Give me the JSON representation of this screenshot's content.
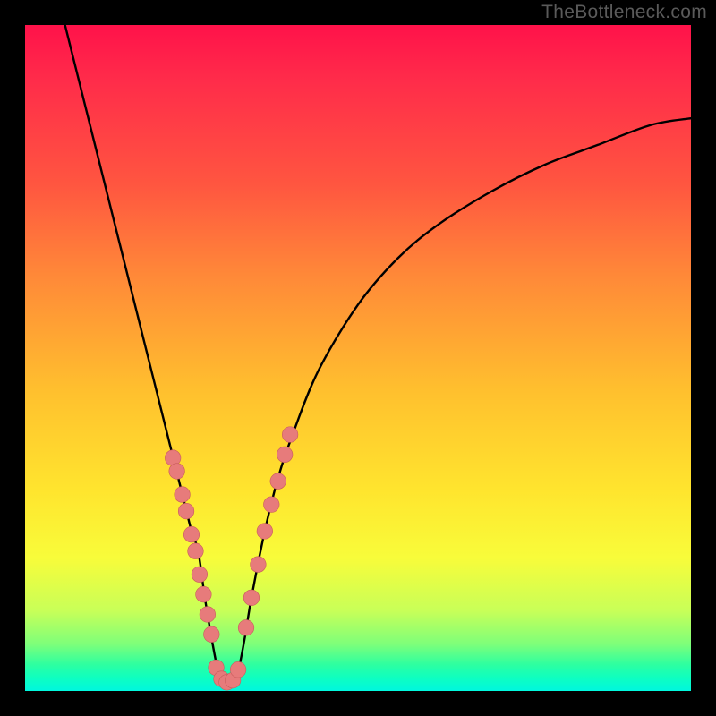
{
  "watermark": "TheBottleneck.com",
  "colors": {
    "frame": "#000000",
    "curve": "#000000",
    "marker_fill": "#e77b7b",
    "marker_stroke": "#c85c5c"
  },
  "chart_data": {
    "type": "line",
    "title": "",
    "xlabel": "",
    "ylabel": "",
    "xlim": [
      0,
      100
    ],
    "ylim": [
      0,
      100
    ],
    "grid": false,
    "background": "vertical-gradient red→yellow→green",
    "series": [
      {
        "name": "bottleneck-curve",
        "x": [
          6,
          8,
          10,
          12,
          14,
          16,
          18,
          20,
          22,
          24,
          25,
          26,
          27,
          28,
          29,
          30,
          31,
          32,
          33,
          34,
          36,
          38,
          40,
          44,
          50,
          56,
          62,
          70,
          78,
          86,
          94,
          100
        ],
        "y": [
          100,
          92,
          84,
          76,
          68,
          60,
          52,
          44,
          36,
          28,
          24,
          21,
          14,
          8,
          3,
          1,
          1,
          3,
          8,
          14,
          24,
          32,
          38,
          48,
          58,
          65,
          70,
          75,
          79,
          82,
          85,
          86
        ]
      }
    ],
    "markers": [
      {
        "name": "left-cluster",
        "series": "bottleneck-curve",
        "points": [
          {
            "x": 22.2,
            "y": 35
          },
          {
            "x": 22.8,
            "y": 33
          },
          {
            "x": 23.6,
            "y": 29.5
          },
          {
            "x": 24.2,
            "y": 27
          },
          {
            "x": 25.0,
            "y": 23.5
          },
          {
            "x": 25.6,
            "y": 21
          },
          {
            "x": 26.2,
            "y": 17.5
          },
          {
            "x": 26.8,
            "y": 14.5
          },
          {
            "x": 27.4,
            "y": 11.5
          },
          {
            "x": 28.0,
            "y": 8.5
          }
        ]
      },
      {
        "name": "bottom-cluster",
        "series": "bottleneck-curve",
        "points": [
          {
            "x": 28.7,
            "y": 3.5
          },
          {
            "x": 29.5,
            "y": 1.8
          },
          {
            "x": 30.3,
            "y": 1.3
          },
          {
            "x": 31.2,
            "y": 1.6
          },
          {
            "x": 32.0,
            "y": 3.2
          }
        ]
      },
      {
        "name": "right-cluster",
        "series": "bottleneck-curve",
        "points": [
          {
            "x": 33.2,
            "y": 9.5
          },
          {
            "x": 34.0,
            "y": 14.0
          },
          {
            "x": 35.0,
            "y": 19.0
          },
          {
            "x": 36.0,
            "y": 24.0
          },
          {
            "x": 37.0,
            "y": 28.0
          },
          {
            "x": 38.0,
            "y": 31.5
          },
          {
            "x": 39.0,
            "y": 35.5
          },
          {
            "x": 39.8,
            "y": 38.5
          }
        ]
      }
    ]
  }
}
